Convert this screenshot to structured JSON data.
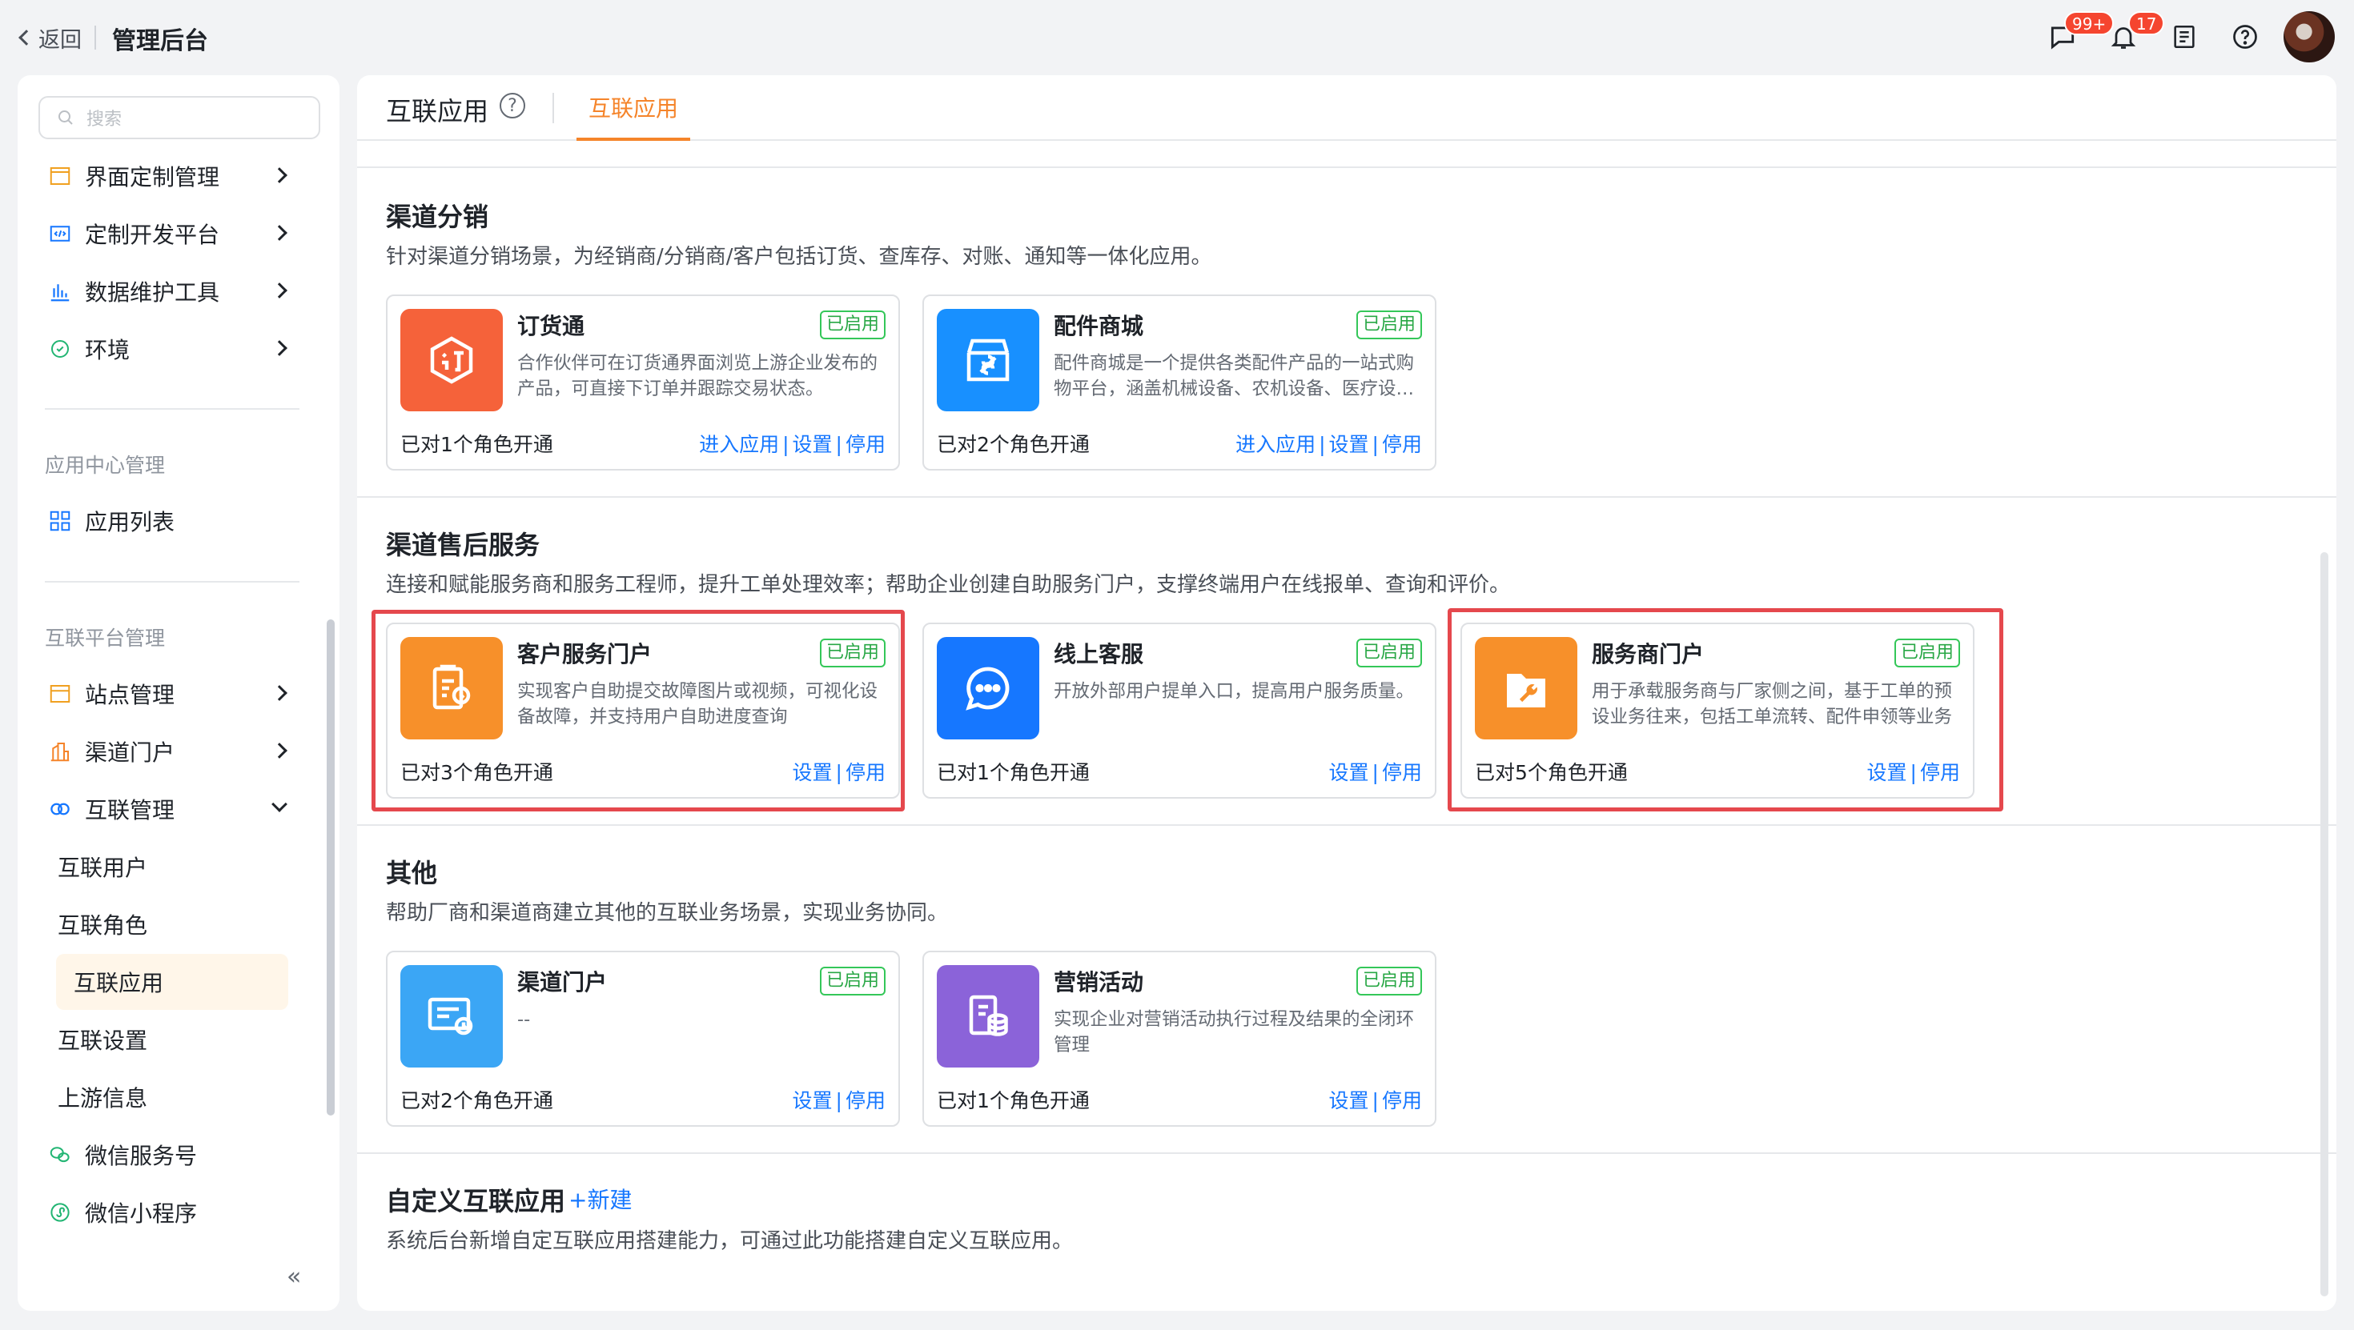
{
  "topbar": {
    "back_label": "返回",
    "title": "管理后台",
    "chat_badge": "99+",
    "bell_badge": "17"
  },
  "sidebar": {
    "search_placeholder": "搜索",
    "items_top": [
      {
        "label": "界面定制管理",
        "icon": "layout-icon"
      },
      {
        "label": "定制开发平台",
        "icon": "code-icon"
      },
      {
        "label": "数据维护工具",
        "icon": "bar-chart-icon"
      },
      {
        "label": "环境",
        "icon": "environment-icon"
      }
    ],
    "section_app_center": "应用中心管理",
    "app_list": "应用列表",
    "section_interconnect": "互联平台管理",
    "site_manage": "站点管理",
    "channel_portal": "渠道门户",
    "interconnect_manage": "互联管理",
    "sub_items": [
      "互联用户",
      "互联角色",
      "互联应用",
      "互联设置",
      "上游信息"
    ],
    "wechat_service": "微信服务号",
    "wechat_mini": "微信小程序",
    "collapse_icon": "«"
  },
  "main": {
    "tab_title": "互联应用",
    "help_icon": "?",
    "active_tab": "互联应用",
    "enabled_tag": "已启用",
    "link_enter": "进入应用",
    "link_settings": "设置",
    "link_disable": "停用",
    "separator": "|",
    "sections": [
      {
        "title": "渠道分销",
        "desc": "针对渠道分销场景，为经销商/分销商/客户包括订货、查库存、对账、通知等一体化应用。",
        "cards": [
          {
            "name": "订货通",
            "desc": "合作伙伴可在订货通界面浏览上游企业发布的产品，可直接下订单并跟踪交易状态。",
            "roles": "已对1个角色开通",
            "color": "#f5623a",
            "icon": "order-icon"
          },
          {
            "name": "配件商城",
            "desc": "配件商城是一个提供各类配件产品的一站式购物平台，涵盖机械设备、农机设备、医疗设备等",
            "roles": "已对2个角色开通",
            "color": "#1890ff",
            "icon": "store-icon"
          }
        ]
      },
      {
        "title": "渠道售后服务",
        "desc": "连接和赋能服务商和服务工程师，提升工单处理效率；帮助企业创建自助服务门户，支撑终端用户在线报单、查询和评价。",
        "cards": [
          {
            "name": "客户服务门户",
            "desc": "实现客户自助提交故障图片或视频，可视化设备故障，并支持用户自助进度查询",
            "roles": "已对3个角色开通",
            "color": "#f7902a",
            "icon": "service-form-icon"
          },
          {
            "name": "线上客服",
            "desc": "开放外部用户提单入口，提高用户服务质量。",
            "roles": "已对1个角色开通",
            "color": "#1677ff",
            "icon": "chat-bubble-icon"
          },
          {
            "name": "服务商门户",
            "desc": "用于承载服务商与厂家侧之间，基于工单的预设业务往来，包括工单流转、配件申领等业务",
            "roles": "已对5个角色开通",
            "color": "#f7902a",
            "icon": "wrench-icon"
          }
        ]
      },
      {
        "title": "其他",
        "desc": "帮助厂商和渠道商建立其他的互联业务场景，实现业务协同。",
        "cards": [
          {
            "name": "渠道门户",
            "desc": "--",
            "roles": "已对2个角色开通",
            "color": "#3ba6f5",
            "icon": "portal-icon"
          },
          {
            "name": "营销活动",
            "desc": "实现企业对营销活动执行过程及结果的全闭环管理",
            "roles": "已对1个角色开通",
            "color": "#8b63d9",
            "icon": "marketing-icon"
          }
        ]
      }
    ],
    "custom": {
      "title": "自定义互联应用",
      "new_label": "+新建",
      "desc": "系统后台新增自定互联应用搭建能力，可通过此功能搭建自定义互联应用。"
    }
  }
}
